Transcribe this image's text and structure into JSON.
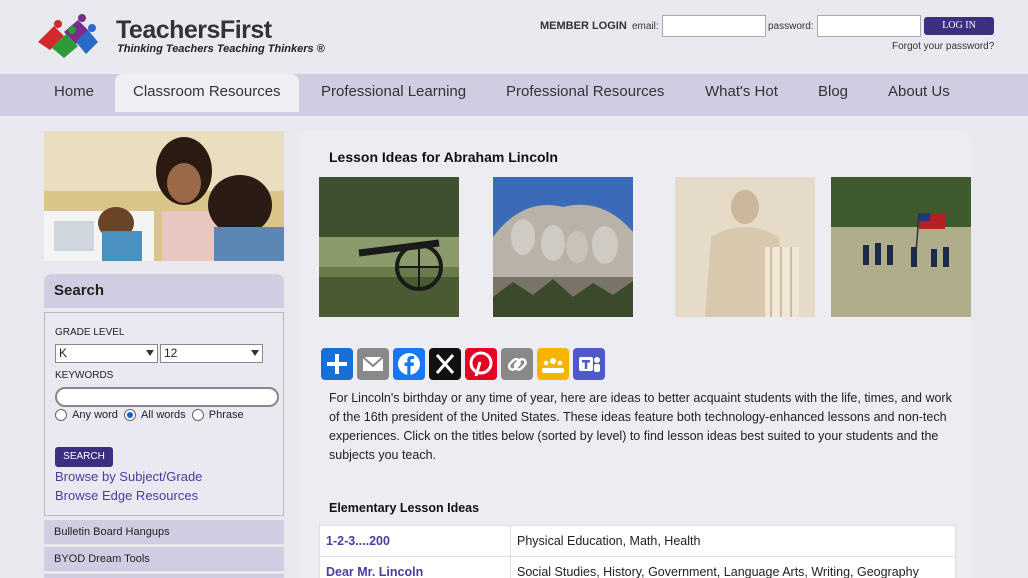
{
  "brand": {
    "name": "TeachersFirst",
    "tagline": "Thinking Teachers Teaching Thinkers ®"
  },
  "login": {
    "title": "MEMBER LOGIN",
    "email_label": "email:",
    "password_label": "password:",
    "button": "LOG IN",
    "forgot": "Forgot your password?"
  },
  "nav": {
    "items": [
      {
        "label": "Home"
      },
      {
        "label": "Classroom Resources"
      },
      {
        "label": "Professional Learning"
      },
      {
        "label": "Professional Resources"
      },
      {
        "label": "What's Hot"
      },
      {
        "label": "Blog"
      },
      {
        "label": "About Us"
      }
    ],
    "active": "Classroom Resources"
  },
  "search": {
    "heading": "Search",
    "grade_label": "GRADE LEVEL",
    "grade_from": "K",
    "grade_to": "12",
    "keywords_label": "KEYWORDS",
    "keywords_value": "",
    "options": [
      "Any word",
      "All words",
      "Phrase"
    ],
    "selected_option": "All words",
    "button": "SEARCH",
    "link_subject": "Browse by Subject/Grade",
    "link_edge": "Browse Edge Resources"
  },
  "sidebar": {
    "items": [
      {
        "label": "Bulletin Board Hangups"
      },
      {
        "label": "BYOD Dream Tools"
      }
    ]
  },
  "main": {
    "title": "Lesson Ideas for Abraham Lincoln",
    "share_icons": [
      "share-icon",
      "email-icon",
      "facebook-icon",
      "x-icon",
      "pinterest-icon",
      "copy-link-icon",
      "google-classroom-icon",
      "teams-icon"
    ],
    "intro": "For Lincoln's birthday or any time of year, here are ideas to better acquaint students with the life, times, and work of the 16th president of the United States. These ideas feature both technology-enhanced lessons and non-tech experiences. Click on the titles below (sorted by level) to find lesson ideas best suited to your students and the subjects you teach.",
    "section_heading": "Elementary Lesson Ideas",
    "lessons": [
      {
        "title": "1-2-3....200",
        "subjects": "Physical Education, Math, Health"
      },
      {
        "title": "Dear Mr. Lincoln",
        "subjects": "Social Studies, History, Government, Language Arts, Writing, Geography"
      }
    ]
  },
  "colors": {
    "accent": "#3c2f80",
    "nav_bg": "#d0cde3",
    "link": "#4b3ca0"
  }
}
